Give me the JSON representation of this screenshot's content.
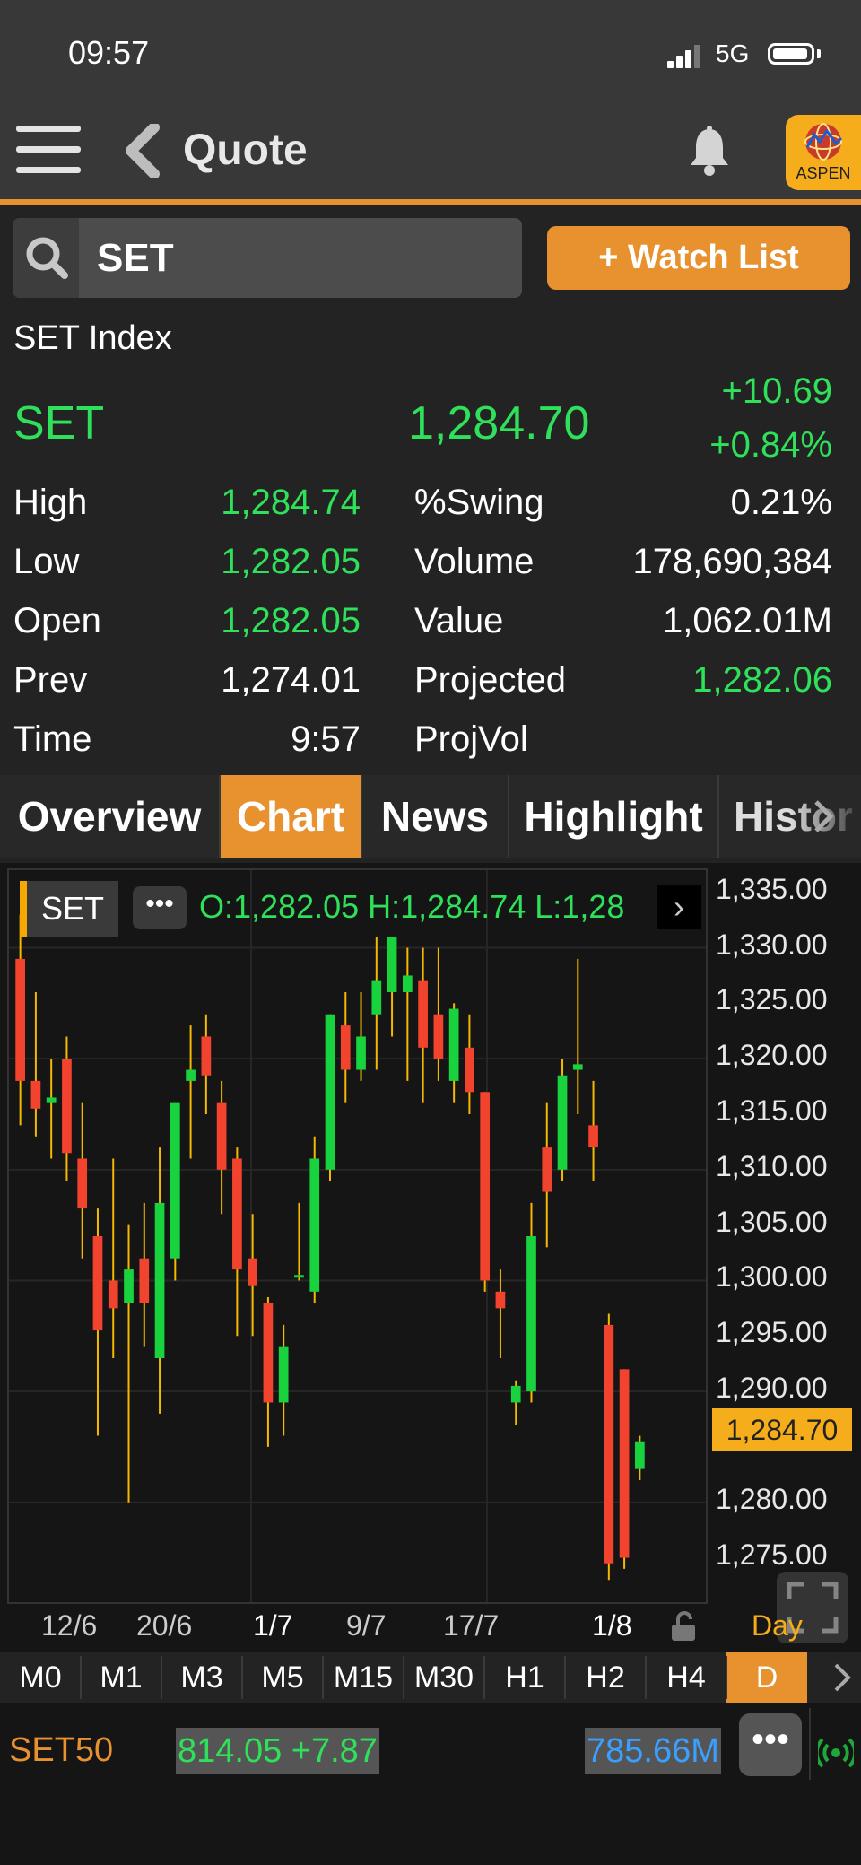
{
  "status_bar": {
    "time": "09:57",
    "network": "5G"
  },
  "header": {
    "title": "Quote",
    "logo_text": "ASPEN"
  },
  "search": {
    "value": "SET"
  },
  "watchlist_button": "+ Watch List",
  "quote": {
    "index_name": "SET Index",
    "symbol": "SET",
    "last": "1,284.70",
    "change": "+10.69",
    "change_pct": "+0.84%",
    "high_label": "High",
    "high": "1,284.74",
    "low_label": "Low",
    "low": "1,282.05",
    "open_label": "Open",
    "open": "1,282.05",
    "prev_label": "Prev",
    "prev": "1,274.01",
    "time_label": "Time",
    "time": "9:57",
    "swing_label": "%Swing",
    "swing": "0.21%",
    "volume_label": "Volume",
    "volume": "178,690,384",
    "value_label": "Value",
    "value": "1,062.01M",
    "projected_label": "Projected",
    "projected": "1,282.06",
    "projvol_label": "ProjVol"
  },
  "tabs": [
    "Overview",
    "Chart",
    "News",
    "Highlight",
    "Histor"
  ],
  "active_tab": "Chart",
  "chart": {
    "symbol_chip": "SET",
    "ohlc_text": "O:1,282.05  H:1,284.74  L:1,28",
    "current_price_label": "1,284.70",
    "period_label": "Day"
  },
  "chart_data": {
    "type": "candlestick",
    "ylim": [
      1271,
      1337
    ],
    "y_ticks": [
      "1,335.00",
      "1,330.00",
      "1,325.00",
      "1,320.00",
      "1,315.00",
      "1,310.00",
      "1,305.00",
      "1,300.00",
      "1,295.00",
      "1,290.00",
      "1,280.00",
      "1,275.00"
    ],
    "x_ticks": [
      "12/6",
      "20/6",
      "1/7",
      "9/7",
      "17/7",
      "1/8"
    ],
    "up_color": "#18d23e",
    "down_color": "#f2432e",
    "wick_color": "#f5b800",
    "candles": [
      {
        "o": 1329,
        "h": 1333,
        "l": 1314,
        "c": 1318
      },
      {
        "o": 1318,
        "h": 1326,
        "l": 1313,
        "c": 1315.5
      },
      {
        "o": 1316,
        "h": 1320,
        "l": 1311,
        "c": 1316.5
      },
      {
        "o": 1320,
        "h": 1322,
        "l": 1309,
        "c": 1311.5
      },
      {
        "o": 1311,
        "h": 1316,
        "l": 1302,
        "c": 1306.5
      },
      {
        "o": 1304,
        "h": 1306.5,
        "l": 1286,
        "c": 1295.5
      },
      {
        "o": 1300,
        "h": 1311,
        "l": 1293,
        "c": 1297.5
      },
      {
        "o": 1298,
        "h": 1305,
        "l": 1280,
        "c": 1301
      },
      {
        "o": 1302,
        "h": 1307,
        "l": 1294,
        "c": 1298
      },
      {
        "o": 1293,
        "h": 1312,
        "l": 1288,
        "c": 1307
      },
      {
        "o": 1302,
        "h": 1316,
        "l": 1300,
        "c": 1316
      },
      {
        "o": 1318,
        "h": 1323,
        "l": 1311,
        "c": 1319
      },
      {
        "o": 1322,
        "h": 1324,
        "l": 1315,
        "c": 1318.5
      },
      {
        "o": 1316,
        "h": 1318,
        "l": 1306,
        "c": 1310
      },
      {
        "o": 1311,
        "h": 1312,
        "l": 1295,
        "c": 1301
      },
      {
        "o": 1302,
        "h": 1306,
        "l": 1295,
        "c": 1299.5
      },
      {
        "o": 1298,
        "h": 1298.5,
        "l": 1285,
        "c": 1289
      },
      {
        "o": 1289,
        "h": 1296,
        "l": 1286,
        "c": 1294
      },
      {
        "o": 1300.5,
        "h": 1307,
        "l": 1300,
        "c": 1300.5
      },
      {
        "o": 1299,
        "h": 1313,
        "l": 1298,
        "c": 1311
      },
      {
        "o": 1310,
        "h": 1324,
        "l": 1309,
        "c": 1324
      },
      {
        "o": 1323,
        "h": 1326,
        "l": 1316,
        "c": 1319
      },
      {
        "o": 1319,
        "h": 1326,
        "l": 1318,
        "c": 1322
      },
      {
        "o": 1324,
        "h": 1331,
        "l": 1319,
        "c": 1327
      },
      {
        "o": 1326,
        "h": 1331,
        "l": 1322,
        "c": 1331
      },
      {
        "o": 1326,
        "h": 1330,
        "l": 1318,
        "c": 1327.5
      },
      {
        "o": 1327,
        "h": 1330,
        "l": 1316,
        "c": 1321
      },
      {
        "o": 1324,
        "h": 1330,
        "l": 1318,
        "c": 1320
      },
      {
        "o": 1318,
        "h": 1325,
        "l": 1316,
        "c": 1324.5
      },
      {
        "o": 1321,
        "h": 1324,
        "l": 1315,
        "c": 1317
      },
      {
        "o": 1317,
        "h": 1317,
        "l": 1299,
        "c": 1300
      },
      {
        "o": 1299,
        "h": 1301,
        "l": 1293,
        "c": 1297.5
      },
      {
        "o": 1289,
        "h": 1291,
        "l": 1287,
        "c": 1290.5
      },
      {
        "o": 1290,
        "h": 1307,
        "l": 1289,
        "c": 1304
      },
      {
        "o": 1312,
        "h": 1316,
        "l": 1303,
        "c": 1308
      },
      {
        "o": 1310,
        "h": 1320,
        "l": 1309,
        "c": 1318.5
      },
      {
        "o": 1319,
        "h": 1329,
        "l": 1315,
        "c": 1319.5
      },
      {
        "o": 1314,
        "h": 1318,
        "l": 1309,
        "c": 1312
      },
      {
        "o": 1296,
        "h": 1297,
        "l": 1273,
        "c": 1274.5
      },
      {
        "o": 1292,
        "h": 1289,
        "l": 1274,
        "c": 1275
      },
      {
        "o": 1283,
        "h": 1286,
        "l": 1282,
        "c": 1285.5
      }
    ]
  },
  "timeframes": [
    "M0",
    "M1",
    "M3",
    "M5",
    "M15",
    "M30",
    "H1",
    "H2",
    "H4",
    "D"
  ],
  "active_timeframe": "D",
  "footer": {
    "symbol": "SET50",
    "value": "814.05 +7.87",
    "volume": "785.66M",
    "more": "•••"
  }
}
